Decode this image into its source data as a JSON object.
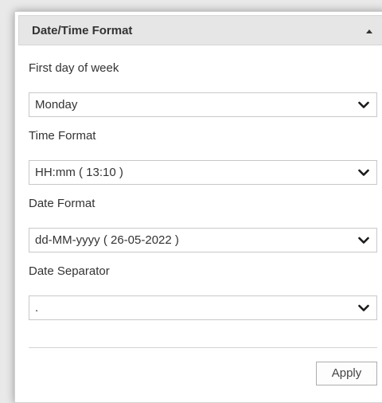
{
  "panel": {
    "title": "Date/Time Format",
    "collapse_icon": "caret-up-icon"
  },
  "fields": [
    {
      "label": "First day of week",
      "value": "Monday"
    },
    {
      "label": "Time Format",
      "value": "HH:mm ( 13:10 )"
    },
    {
      "label": "Date Format",
      "value": "dd-MM-yyyy ( 26-05-2022 )"
    },
    {
      "label": "Date Separator",
      "value": "."
    }
  ],
  "select_icon": "chevron-down-icon",
  "actions": {
    "apply_label": "Apply"
  },
  "colors": {
    "header_background": "#e6e6e6",
    "panel_background": "#ffffff",
    "border": "#c8c8c8"
  }
}
